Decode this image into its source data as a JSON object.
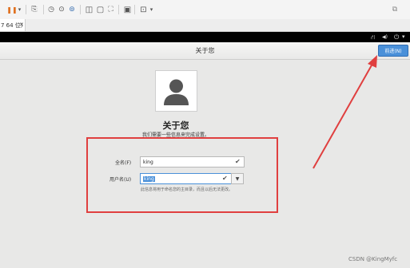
{
  "toolbar": {
    "items": [
      {
        "name": "pause-icon",
        "glyph": "❚❚"
      },
      {
        "name": "dropdown-arrow-icon",
        "glyph": "▾"
      },
      {
        "name": "send-keys-icon",
        "glyph": "⎘"
      },
      {
        "name": "clock-icon",
        "glyph": "◷"
      },
      {
        "name": "snapshot-icon",
        "glyph": "⊙"
      },
      {
        "name": "snapshot-manager-icon",
        "glyph": "⊚"
      },
      {
        "name": "split-view-icon",
        "glyph": "◫"
      },
      {
        "name": "window-icon",
        "glyph": "▢"
      },
      {
        "name": "fullscreen-icon",
        "glyph": "⛶"
      },
      {
        "name": "console-icon",
        "glyph": "▣"
      },
      {
        "name": "view-icon",
        "glyph": "⊡"
      },
      {
        "name": "dropdown-arrow-icon",
        "glyph": "▾"
      }
    ]
  },
  "vm_tab": {
    "label": "7 64 位)"
  },
  "tray": {
    "network": "⛙",
    "volume": "◀)",
    "power": "⏻",
    "arrow": "▾"
  },
  "header": {
    "title": "关于您",
    "next_button": "前进(N)"
  },
  "page": {
    "title": "关于您",
    "subtitle": "我们需要一些信息来完成设置。"
  },
  "form": {
    "fullname_label": "全名(F)",
    "fullname_value": "king",
    "username_label": "用户名(U)",
    "username_value": "king",
    "hint": "此信息将用于命名您的主目录，而且以后无法更改。"
  },
  "watermark": "CSDN @KingMyfc",
  "colors": {
    "annotation": "#e03f3f",
    "accent": "#4a90d9"
  }
}
